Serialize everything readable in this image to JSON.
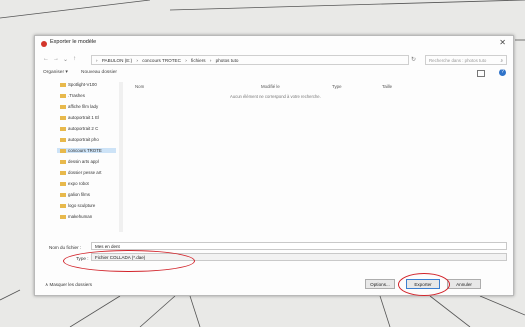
{
  "window": {
    "title": "Exporter le modèle",
    "close_icon": "✕"
  },
  "nav": {
    "path": [
      "PABULON (E:)",
      "concours TROTEC",
      "fichiers",
      "photos tuto"
    ],
    "search_placeholder": "Recherche dans : photos tuto"
  },
  "toolbar": {
    "organize": "Organiser ▾",
    "new_folder": "Nouveau dossier"
  },
  "sidebar": {
    "items": [
      "Spotlight-V100",
      ".Trashes",
      "affiche film lady",
      "autoportrait 1 El",
      "autoportrait 2 C",
      "autoportrait pho",
      "concours TROTE",
      "dessin arts appl",
      "dossier pesse art",
      "expo robot",
      "galion films",
      "logo sculpture",
      "makehuman"
    ]
  },
  "columns": [
    "Nom",
    "Modifié le",
    "Type",
    "Taille"
  ],
  "empty_message": "Aucun élément ne correspond à votre recherche.",
  "filename": {
    "label": "Nom du fichier :",
    "value": "Mes en dent"
  },
  "filetype": {
    "label": "Type :",
    "value": "Fichier COLLADA (*.dae)"
  },
  "footer": {
    "hide_folders": "∧ Masquer les dossiers",
    "options": "Options...",
    "export": "Exporter",
    "cancel": "Annuler"
  }
}
